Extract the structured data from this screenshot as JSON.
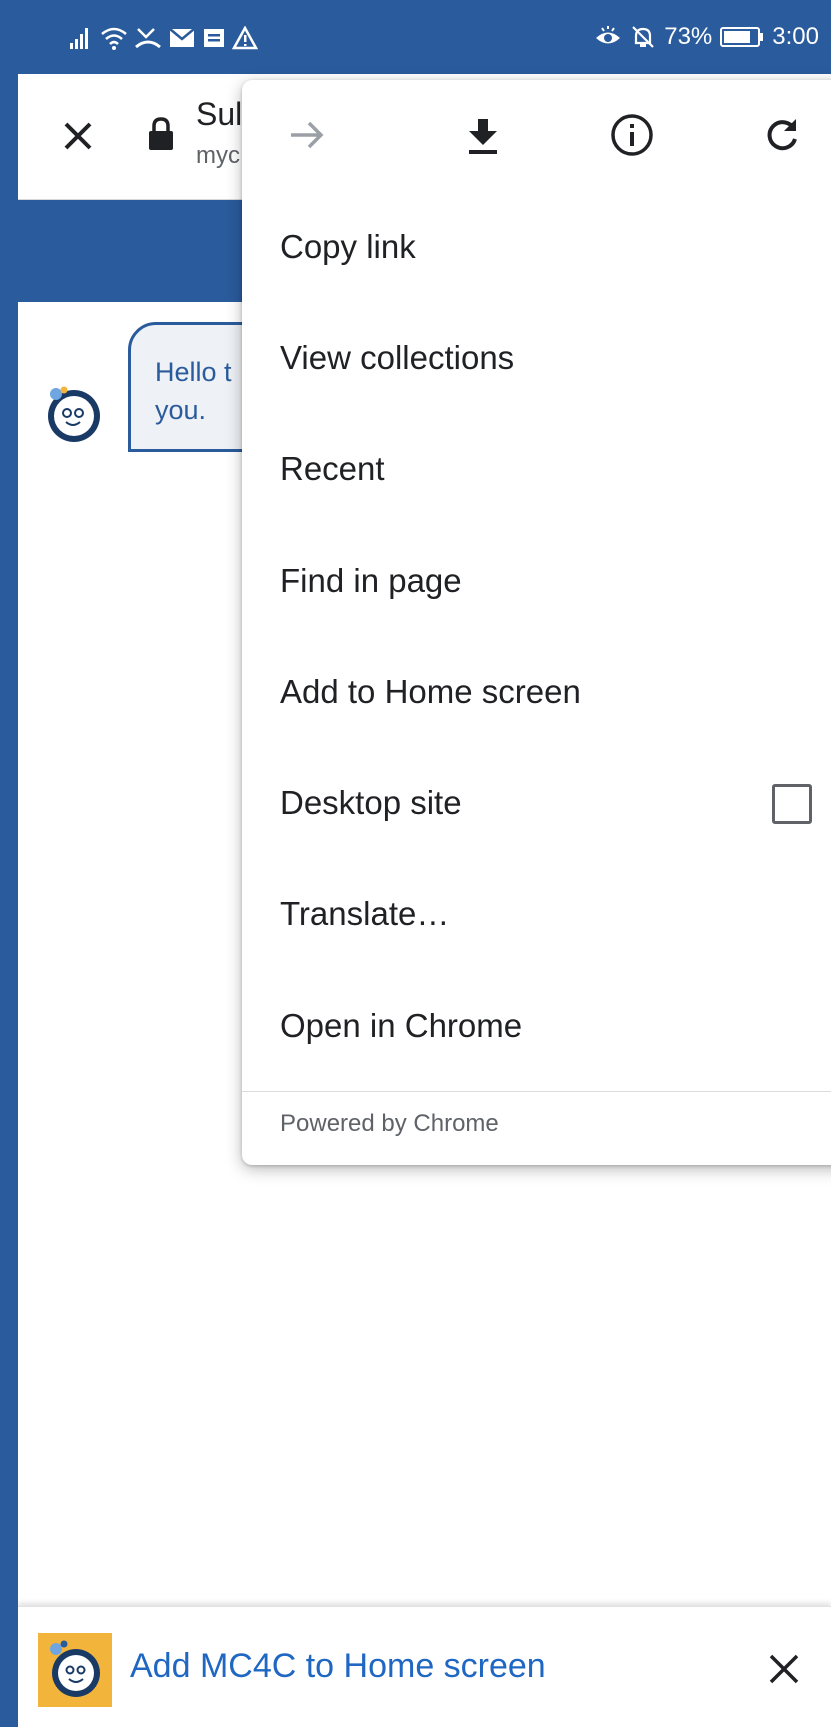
{
  "status_bar": {
    "battery": "73%",
    "time": "3:00"
  },
  "toolbar": {
    "title": "Sul",
    "url": "myc"
  },
  "chat": {
    "line1": "Hello t",
    "line2": "you."
  },
  "menu": {
    "items": [
      {
        "label": "Copy link"
      },
      {
        "label": "View collections"
      },
      {
        "label": "Recent"
      },
      {
        "label": "Find in page"
      },
      {
        "label": "Add to Home screen"
      },
      {
        "label": "Desktop site"
      },
      {
        "label": "Translate…"
      },
      {
        "label": "Open in Chrome"
      }
    ],
    "footer": "Powered by Chrome"
  },
  "banner": {
    "text": "Add MC4C to Home screen"
  },
  "colors": {
    "brand_blue": "#2a5b9c",
    "link_blue": "#1f67c2",
    "banner_logo_bg": "#f3b43b"
  }
}
